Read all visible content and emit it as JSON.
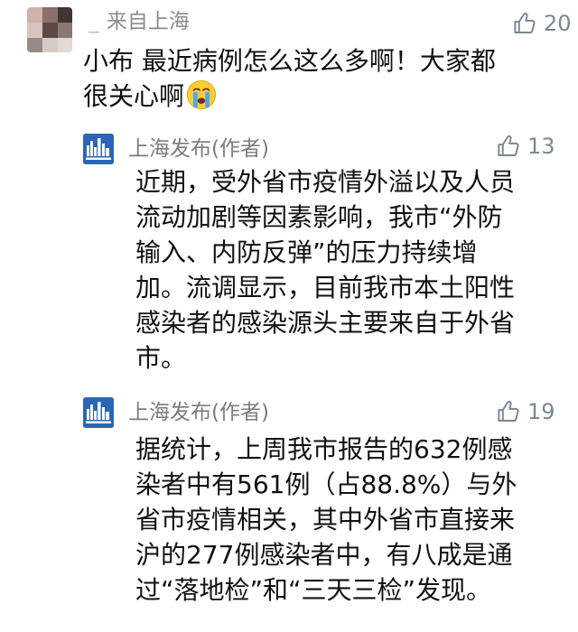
{
  "comments": [
    {
      "author": "来自上海",
      "author_prefix": "_",
      "likes": "20",
      "lines": [
        "小布 最近病例怎么这么多啊！大家都",
        "很关心啊"
      ],
      "emoji": "crying-face"
    }
  ],
  "replies": [
    {
      "author": "上海发布(作者)",
      "likes": "13",
      "lines": [
        "近期，受外省市疫情外溢以及人员",
        "流动加剧等因素影响，我市“外防",
        "输入、内防反弹”的压力持续增",
        "加。流调显示，目前我市本土阳性",
        "感染者的感染源头主要来自于外省",
        "市。"
      ]
    },
    {
      "author": "上海发布(作者)",
      "likes": "19",
      "lines": [
        "据统计，上周我市报告的632例感",
        "染者中有561例（占88.8%）与外",
        "省市疫情相关，其中外省市直接来",
        "沪的277例感染者中，有八成是通",
        "过“落地检”和“三天三检”发现。"
      ]
    }
  ],
  "colors": {
    "org_avatar": "#2b66b4",
    "like_icon": "#7d8794",
    "author_gray": "#8c8c8c"
  },
  "icons": {
    "like": "thumbs-up-icon",
    "org_avatar": "city-skyline-icon"
  }
}
